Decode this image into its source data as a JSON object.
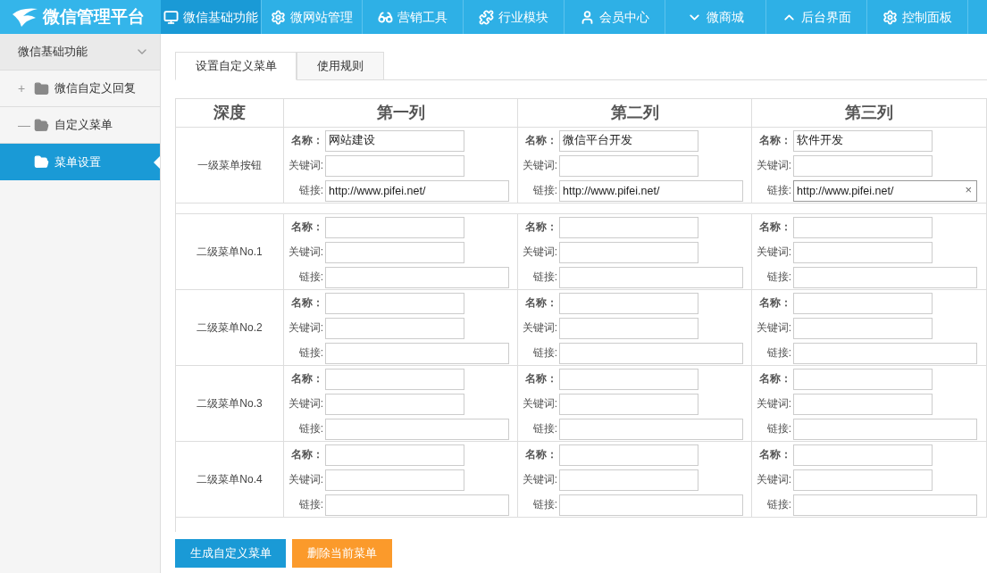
{
  "logo": {
    "title": "微信管理平台"
  },
  "nav": [
    {
      "label": "微信基础功能",
      "selected": true
    },
    {
      "label": "微网站管理",
      "selected": false
    },
    {
      "label": "营销工具",
      "selected": false
    },
    {
      "label": "行业模块",
      "selected": false
    },
    {
      "label": "会员中心",
      "selected": false
    },
    {
      "label": "微商城",
      "selected": false
    },
    {
      "label": "后台界面",
      "selected": false
    },
    {
      "label": "控制面板",
      "selected": false
    }
  ],
  "sidebar": {
    "header": "微信基础功能",
    "expanded": true,
    "items": [
      {
        "label": "微信自定义回复",
        "toggle": "+",
        "expanded": false,
        "selected": false
      },
      {
        "label": "自定义菜单",
        "toggle": "—",
        "expanded": true,
        "selected": false,
        "children": [
          {
            "label": "菜单设置",
            "selected": true
          }
        ]
      }
    ]
  },
  "tabs": [
    {
      "label": "设置自定义菜单",
      "selected": true
    },
    {
      "label": "使用规则",
      "selected": false
    }
  ],
  "table": {
    "columns": [
      "深度",
      "第一列",
      "第二列",
      "第三列"
    ],
    "rows": [
      {
        "label": "一级菜单按钮",
        "cells": [
          {
            "fields": [
              {
                "label": "名称：",
                "bold": true,
                "value": "网站建设"
              },
              {
                "label": "关键词:"
              },
              {
                "label": "链接:",
                "value": "http://www.pifei.net/"
              }
            ]
          },
          {
            "fields": [
              {
                "label": "名称：",
                "bold": true,
                "value": "微信平台开发"
              },
              {
                "label": "关键词:"
              },
              {
                "label": "链接:",
                "value": "http://www.pifei.net/"
              }
            ]
          },
          {
            "fields": [
              {
                "label": "名称：",
                "bold": true,
                "value": "软件开发"
              },
              {
                "label": "关键词:"
              },
              {
                "label": "链接:",
                "value": "http://www.pifei.net/",
                "focused": true,
                "clear": "×"
              }
            ]
          }
        ]
      },
      {
        "label": "二级菜单No.1",
        "cells": [
          {
            "fields": [
              {
                "label": "名称：",
                "bold": true
              },
              {
                "label": "关键词:"
              },
              {
                "label": "链接:"
              }
            ]
          },
          {
            "fields": [
              {
                "label": "名称：",
                "bold": true
              },
              {
                "label": "关键词:"
              },
              {
                "label": "链接:"
              }
            ]
          },
          {
            "fields": [
              {
                "label": "名称：",
                "bold": true
              },
              {
                "label": "关键词:"
              },
              {
                "label": "链接:"
              }
            ]
          }
        ]
      },
      {
        "label": "二级菜单No.2",
        "cells": [
          {
            "fields": [
              {
                "label": "名称：",
                "bold": true
              },
              {
                "label": "关键词:"
              },
              {
                "label": "链接:"
              }
            ]
          },
          {
            "fields": [
              {
                "label": "名称：",
                "bold": true
              },
              {
                "label": "关键词:"
              },
              {
                "label": "链接:"
              }
            ]
          },
          {
            "fields": [
              {
                "label": "名称：",
                "bold": true
              },
              {
                "label": "关键词:"
              },
              {
                "label": "链接:"
              }
            ]
          }
        ]
      },
      {
        "label": "二级菜单No.3",
        "cells": [
          {
            "fields": [
              {
                "label": "名称：",
                "bold": true
              },
              {
                "label": "关键词:"
              },
              {
                "label": "链接:"
              }
            ]
          },
          {
            "fields": [
              {
                "label": "名称：",
                "bold": true
              },
              {
                "label": "关键词:"
              },
              {
                "label": "链接:"
              }
            ]
          },
          {
            "fields": [
              {
                "label": "名称：",
                "bold": true
              },
              {
                "label": "关键词:"
              },
              {
                "label": "链接:"
              }
            ]
          }
        ]
      },
      {
        "label": "二级菜单No.4",
        "cells": [
          {
            "fields": [
              {
                "label": "名称：",
                "bold": true
              },
              {
                "label": "关键词:"
              },
              {
                "label": "链接:"
              }
            ]
          },
          {
            "fields": [
              {
                "label": "名称：",
                "bold": true
              },
              {
                "label": "关键词:"
              },
              {
                "label": "链接:"
              }
            ]
          },
          {
            "fields": [
              {
                "label": "名称：",
                "bold": true
              },
              {
                "label": "关键词:"
              },
              {
                "label": "链接:"
              }
            ]
          }
        ]
      }
    ]
  },
  "buttons": [
    {
      "label": "生成自定义菜单",
      "kind": "primary"
    },
    {
      "label": "删除当前菜单",
      "kind": "warning"
    }
  ]
}
